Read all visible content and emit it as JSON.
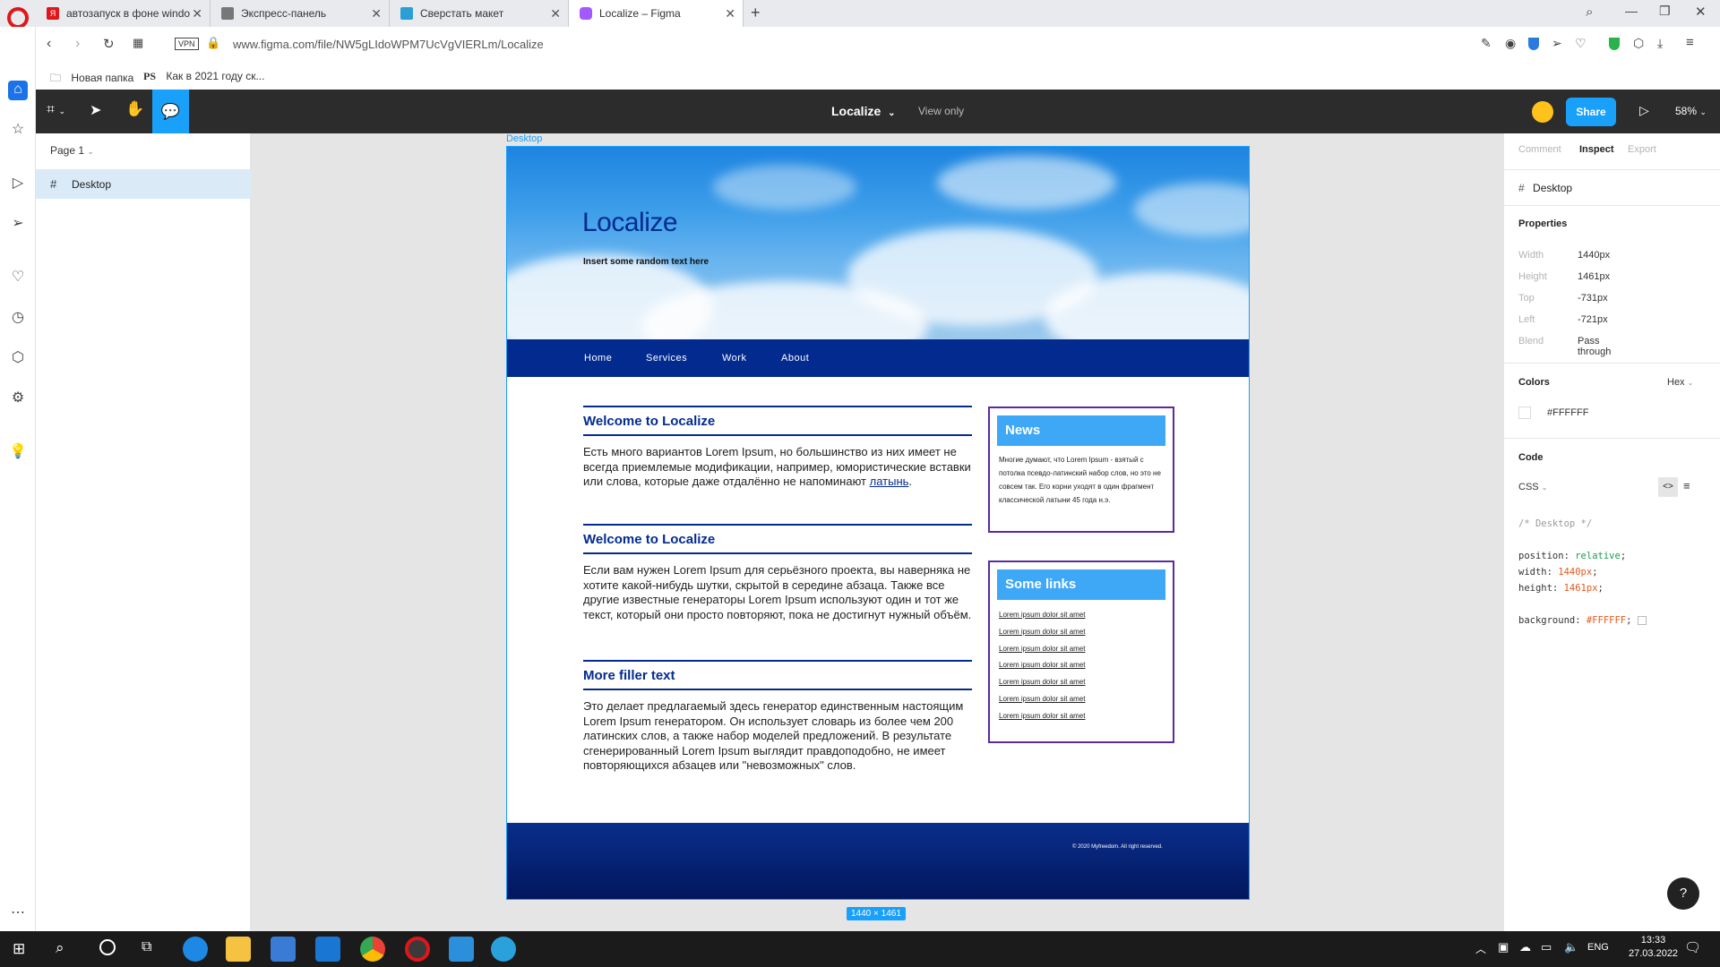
{
  "browser": {
    "tabs": [
      {
        "label": "автозапуск в фоне windo",
        "fav_color": "#e0161b",
        "fav_text": "Я"
      },
      {
        "label": "Экспресс-панель",
        "fav_color": "#555555",
        "fav_text": ""
      },
      {
        "label": "Сверстать макет",
        "fav_color": "#2a9fd6",
        "fav_text": ""
      },
      {
        "label": "Localize – Figma",
        "fav_color": "#a259ff",
        "fav_text": ""
      }
    ],
    "new_tab": "+",
    "vpn_badge": "VPN",
    "url": "www.figma.com/file/NW5gLIdoWPM7UcVgVIERLm/Localize",
    "bookmarks": [
      {
        "icon": "folder-icon",
        "label": "Новая папка"
      },
      {
        "icon": "ps-icon",
        "label": "Как в 2021 году ск..."
      }
    ],
    "ps_text": "PS"
  },
  "figma": {
    "file_name": "Localize",
    "view_mode": "View only",
    "share_label": "Share",
    "zoom": "58%",
    "page_selector": "Page 1",
    "layers": [
      {
        "icon": "frame-icon",
        "label": "Desktop"
      }
    ],
    "frame_label": "Desktop",
    "frame_size": "1440 × 1461",
    "right_tabs": [
      "Comment",
      "Inspect",
      "Export"
    ],
    "selected_layer": "Desktop",
    "properties_title": "Properties",
    "properties": [
      {
        "key": "Width",
        "value": "1440px"
      },
      {
        "key": "Height",
        "value": "1461px"
      },
      {
        "key": "Top",
        "value": "-731px"
      },
      {
        "key": "Left",
        "value": "-721px"
      },
      {
        "key": "Blend",
        "value": "Pass through"
      }
    ],
    "colors_title": "Colors",
    "color_format": "Hex",
    "color_value": "#FFFFFF",
    "code_title": "Code",
    "code_lang": "CSS",
    "code_comment": "/* Desktop */",
    "code_lines": [
      {
        "prop": "position:",
        "val": "relative",
        "val_color": "#1b9b50"
      },
      {
        "prop": "width:",
        "val": "1440px",
        "val_color": "#e35a1e"
      },
      {
        "prop": "height:",
        "val": "1461px",
        "val_color": "#e35a1e"
      },
      {
        "prop": "background:",
        "val": "#FFFFFF",
        "val_color": "#e35a1e"
      }
    ],
    "help": "?"
  },
  "design": {
    "hero_title": "Localize",
    "hero_subtitle": "Insert some random text here",
    "nav": [
      "Home",
      "Services",
      "Work",
      "About"
    ],
    "articles": [
      {
        "heading": "Welcome to Localize",
        "body": "Есть много вариантов Lorem Ipsum, но большинство из них имеет не всегда приемлемые модификации, например, юмористические вставки или слова, которые даже отдалённо не напоминают ",
        "link": "латынь",
        "tail": "."
      },
      {
        "heading": "Welcome to Localize",
        "body": "Если вам нужен Lorem Ipsum для серьёзного проекта, вы наверняка не хотите какой-нибудь шутки, скрытой в середине абзаца. Также все другие известные генераторы Lorem Ipsum используют один и тот же текст, который они просто повторяют, пока не достигнут нужный объём."
      },
      {
        "heading": "More filler text",
        "body": "Это делает предлагаемый здесь генератор единственным настоящим Lorem Ipsum генератором. Он использует словарь из более чем 200 латинских слов, а также набор моделей предложений. В результате сгенерированный Lorem Ipsum выглядит правдоподобно, не имеет повторяющихся абзацев или \"невозможных\" слов."
      }
    ],
    "news_title": "News",
    "news_body": "Многие думают, что Lorem Ipsum - взятый с потолка псевдо-латинский набор слов, но это не совсем так. Его корни уходят в один фрагмент классической латыни 45 года н.э.",
    "links_title": "Some links",
    "links": [
      "Lorem ipsum dolor sit amet",
      "Lorem ipsum dolor sit amet",
      "Lorem ipsum dolor sit amet",
      "Lorem ipsum dolor sit amet",
      "Lorem ipsum dolor sit amet",
      "Lorem ipsum dolor sit amet",
      "Lorem ipsum dolor sit amet"
    ],
    "footer": "© 2020 Myfreedom. All right reserved."
  },
  "taskbar": {
    "lang": "ENG",
    "time": "13:33",
    "date": "27.03.2022"
  }
}
